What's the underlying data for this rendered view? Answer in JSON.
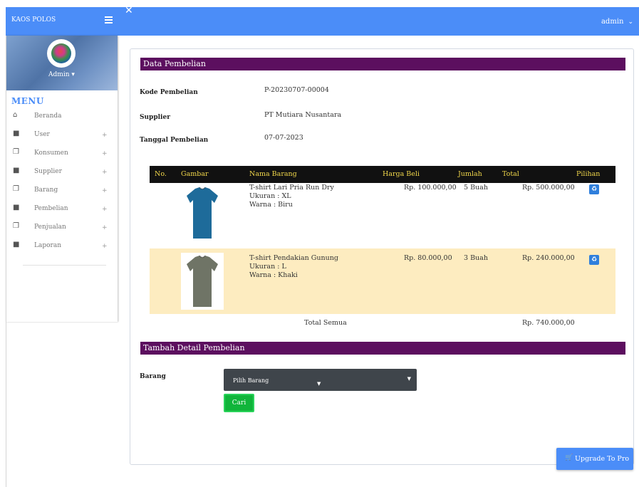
{
  "navbar": {
    "brand": "KAOS POLOS",
    "user_label": "admin"
  },
  "sidebar": {
    "profile_name": "Admin",
    "menu_title": "MENU",
    "items": [
      {
        "label": "Beranda",
        "icon": "home-icon",
        "expandable": false
      },
      {
        "label": "User",
        "icon": "grid-icon",
        "expandable": true
      },
      {
        "label": "Konsumen",
        "icon": "copy-icon",
        "expandable": true
      },
      {
        "label": "Supplier",
        "icon": "grid-icon",
        "expandable": true
      },
      {
        "label": "Barang",
        "icon": "copy-icon",
        "expandable": true
      },
      {
        "label": "Pembelian",
        "icon": "grid-icon",
        "expandable": true
      },
      {
        "label": "Penjualan",
        "icon": "copy-icon",
        "expandable": true
      },
      {
        "label": "Laporan",
        "icon": "grid-icon",
        "expandable": true
      }
    ]
  },
  "purchase": {
    "section_title": "Data Pembelian",
    "fields": {
      "kode_label": "Kode Pembelian",
      "kode_value": "P-20230707-00004",
      "supplier_label": "Supplier",
      "supplier_value": "PT Mutiara Nusantara",
      "tanggal_label": "Tanggal Pembelian",
      "tanggal_value": "07-07-2023"
    }
  },
  "table": {
    "headers": {
      "no": "No.",
      "gambar": "Gambar",
      "nama": "Nama Barang",
      "harga": "Harga Beli",
      "jumlah": "Jumlah",
      "total": "Total",
      "pilihan": "Pilihan"
    },
    "rows": [
      {
        "name": "T-shirt Lari Pria Run Dry",
        "size": "Ukuran : XL",
        "color": "Warna : Biru",
        "price": "Rp. 100.000,00",
        "qty": "5 Buah",
        "total": "Rp. 500.000,00",
        "shirt_color": "#1e6b9a",
        "highlighted": false
      },
      {
        "name": "T-shirt Pendakian Gunung",
        "size": "Ukuran : L",
        "color": "Warna : Khaki",
        "price": "Rp. 80.000,00",
        "qty": "3 Buah",
        "total": "Rp. 240.000,00",
        "shirt_color": "#6f7466",
        "highlighted": true
      }
    ],
    "grand_total_label": "Total Semua",
    "grand_total_value": "Rp. 740.000,00"
  },
  "add_detail": {
    "section_title": "Tambah Detail Pembelian",
    "barang_label": "Barang",
    "select_value": "Pilih Barang",
    "search_button": "Cari"
  },
  "upgrade_button": "Upgrade To Pro",
  "colors": {
    "navbar": "#4b8df8",
    "section_bar": "#5c0f5f",
    "table_header": "#111111",
    "table_header_text": "#f2d84b",
    "row_highlight": "#fdecc0",
    "button_green": "#10b53a"
  }
}
